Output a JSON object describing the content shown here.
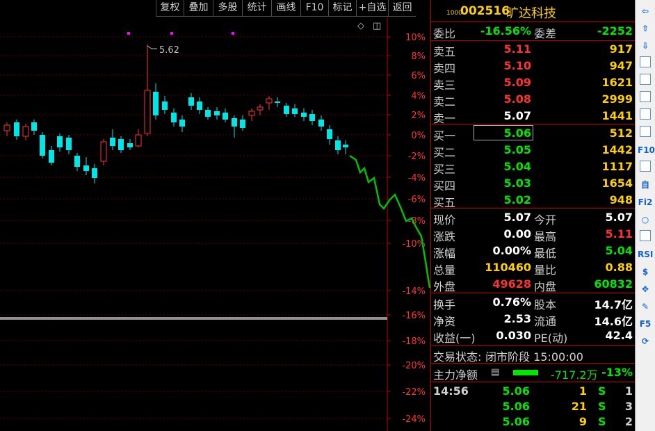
{
  "toolbar": {
    "items": [
      "复权",
      "叠加",
      "多股",
      "统计",
      "画线",
      "F10",
      "标记",
      "+自选",
      "返回"
    ]
  },
  "chart": {
    "pct_ticks": [
      "10%",
      "8%",
      "6%",
      "4%",
      "2%",
      "0%",
      "-2%",
      "-4%",
      "-6%",
      "-8%",
      "-10%",
      "-14%",
      "-16%",
      "-18%",
      "-20%",
      "-22%",
      "-24%"
    ],
    "high_label": "5.62"
  },
  "quote": {
    "small_label": "1000",
    "code": "002516",
    "name": "旷达科技",
    "webi_label": "委比",
    "webi_value": "-16.56%",
    "weicha_label": "委差",
    "weicha_value": "-2252",
    "sells": [
      {
        "label": "卖五",
        "price": "5.11",
        "vol": "917"
      },
      {
        "label": "卖四",
        "price": "5.10",
        "vol": "947"
      },
      {
        "label": "卖三",
        "price": "5.09",
        "vol": "1621"
      },
      {
        "label": "卖二",
        "price": "5.08",
        "vol": "2999"
      },
      {
        "label": "卖一",
        "price": "5.07",
        "vol": "1441"
      }
    ],
    "buys": [
      {
        "label": "买一",
        "price": "5.06",
        "vol": "512"
      },
      {
        "label": "买二",
        "price": "5.05",
        "vol": "1442"
      },
      {
        "label": "买三",
        "price": "5.04",
        "vol": "1117"
      },
      {
        "label": "买四",
        "price": "5.03",
        "vol": "1654"
      },
      {
        "label": "买五",
        "price": "5.02",
        "vol": "948"
      }
    ],
    "stats": [
      {
        "l1": "现价",
        "v1": "5.07",
        "l2": "今开",
        "v2": "5.07"
      },
      {
        "l1": "涨跌",
        "v1": "0.00",
        "l2": "最高",
        "v2": "5.11"
      },
      {
        "l1": "涨幅",
        "v1": "0.00%",
        "l2": "最低",
        "v2": "5.04"
      },
      {
        "l1": "总量",
        "v1": "110460",
        "l2": "量比",
        "v2": "0.88"
      },
      {
        "l1": "外盘",
        "v1": "49628",
        "l2": "内盘",
        "v2": "60832"
      }
    ],
    "fund": [
      {
        "l1": "换手",
        "v1": "0.76%",
        "l2": "股本",
        "v2": "14.7亿"
      },
      {
        "l1": "净资",
        "v1": "2.53",
        "l2": "流通",
        "v2": "14.6亿"
      },
      {
        "l1": "收益(一)",
        "v1": "0.030",
        "l2": "PE(动)",
        "v2": "42.4"
      }
    ],
    "trade_status_label": "交易状态:",
    "trade_status_value": "闭市阶段 15:00:00",
    "main_flow_label": "主力净额",
    "main_flow_value": "-717.2万",
    "main_flow_pct": "-13%",
    "ticks": [
      {
        "time": "14:56",
        "price": "5.06",
        "vol": "1",
        "bs": "S",
        "n": "1"
      },
      {
        "time": "",
        "price": "5.06",
        "vol": "21",
        "bs": "S",
        "n": "3"
      },
      {
        "time": "",
        "price": "5.06",
        "vol": "9",
        "bs": "S",
        "n": "2"
      }
    ]
  },
  "sidebar": {
    "icons": [
      "arrow-left-icon",
      "arrow-up-icon",
      "arrow-down-icon",
      "list-icon",
      "grid-icon",
      "chart-line-icon",
      "candles-icon",
      "report-icon",
      "f10-icon",
      "news-icon",
      "self-icon",
      "f2-icon",
      "circle-icon",
      "wave-icon",
      "rsi-icon",
      "dollar-icon",
      "move-icon",
      "pen-icon",
      "f5-icon",
      "refresh-icon"
    ],
    "labels": [
      "⇦",
      "⇧",
      "⇩",
      "",
      "",
      "",
      "",
      "",
      "F10",
      "",
      "自",
      "Fi2",
      "○",
      "",
      "RSI",
      "$",
      "✥",
      "✎",
      "F5",
      "⟳"
    ]
  }
}
